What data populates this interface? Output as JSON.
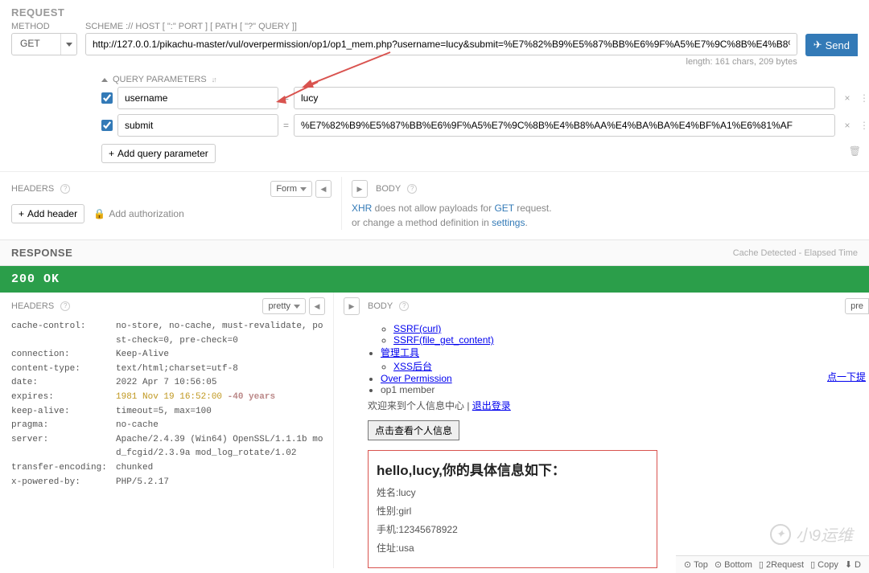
{
  "request": {
    "section": "REQUEST",
    "method_label": "METHOD",
    "method_value": "GET",
    "scheme_label": "SCHEME :// HOST [ \":\" PORT ] [ PATH [ \"?\" QUERY ]]",
    "url": "http://127.0.0.1/pikachu-master/vul/overpermission/op1/op1_mem.php?username=lucy&submit=%E7%82%B9%E5%87%BB%E6%9F%A5%E7%9C%8B%E4%B8%AA%E4%BA%BA%E4%BF%A1%E6",
    "length_hint": "length: 161 chars, 209 bytes",
    "send_label": "Send",
    "qp_title": "QUERY PARAMETERS",
    "params": [
      {
        "name": "username",
        "value": "lucy"
      },
      {
        "name": "submit",
        "value": "%E7%82%B9%E5%87%BB%E6%9F%A5%E7%9C%8B%E4%B8%AA%E4%BA%BA%E4%BF%A1%E6%81%AF"
      }
    ],
    "add_param": "Add query parameter",
    "headers_label": "HEADERS",
    "form_label": "Form",
    "add_header": "Add header",
    "add_auth": "Add authorization",
    "body_label": "BODY",
    "body_msg1a": "XHR",
    "body_msg1b": " does not allow payloads for ",
    "body_msg1c": "GET",
    "body_msg1d": " request.",
    "body_msg2a": "or change a method definition in ",
    "body_msg2b": "settings",
    "body_msg2c": "."
  },
  "response": {
    "section": "RESPONSE",
    "cache_info": "Cache Detected - Elapsed Time",
    "status": "200 OK",
    "headers_label": "HEADERS",
    "pretty_label": "pretty",
    "pre_label": "pre",
    "headers": [
      {
        "k": "cache-control:",
        "v": "no-store, no-cache, must-revalidate, post-check=0, pre-check=0"
      },
      {
        "k": "connection:",
        "v": "Keep-Alive"
      },
      {
        "k": "content-type:",
        "v": "text/html;charset=utf-8"
      },
      {
        "k": "date:",
        "v": "2022 Apr 7 10:56:05"
      },
      {
        "k": "expires:",
        "v": "1981 Nov 19 16:52:00",
        "age": " -40 years"
      },
      {
        "k": "keep-alive:",
        "v": "timeout=5, max=100"
      },
      {
        "k": "pragma:",
        "v": "no-cache"
      },
      {
        "k": "server:",
        "v": "Apache/2.4.39 (Win64) OpenSSL/1.1.1b mod_fcgid/2.3.9a mod_log_rotate/1.02"
      },
      {
        "k": "transfer-encoding:",
        "v": "chunked"
      },
      {
        "k": "x-powered-by:",
        "v": "PHP/5.2.17"
      }
    ],
    "body_label": "BODY",
    "body": {
      "links": {
        "ssrf_curl": "SSRF(curl)",
        "ssrf_fgc": "SSRF(file_get_content)",
        "mgmt": "管理工具",
        "xss": "XSS后台",
        "over_perm": "Over Permission",
        "op1": "op1 member"
      },
      "welcome_a": "欢迎来到个人信息中心 | ",
      "logout": "退出登录",
      "next": "点一下提",
      "view_btn": "点击查看个人信息",
      "hello": "hello,lucy,你的具体信息如下：",
      "name": "姓名:lucy",
      "gender": "性别:girl",
      "phone": "手机:12345678922",
      "addr": "住址:usa"
    },
    "footer": {
      "top": "Top",
      "bottom": "Bottom",
      "req2": "2Request",
      "copy": "Copy",
      "dl": "D"
    }
  },
  "watermark": "小9运维"
}
